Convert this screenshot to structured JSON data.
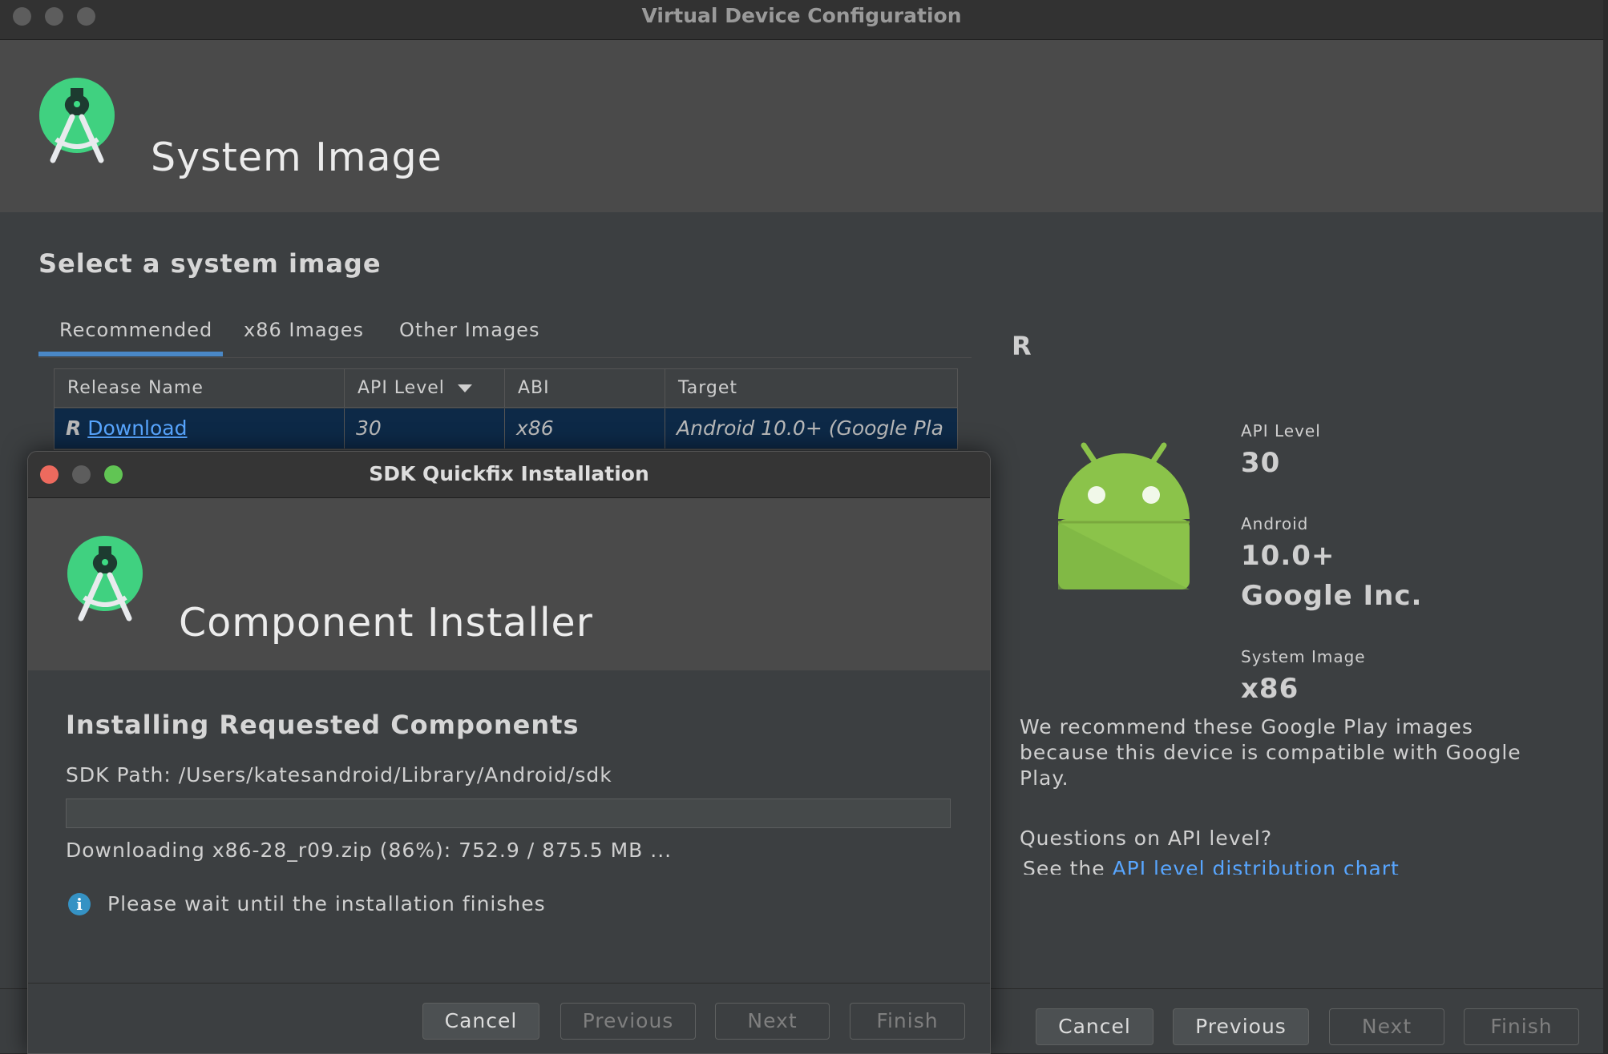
{
  "main_window": {
    "title": "Virtual Device Configuration",
    "header_title": "System Image",
    "section_heading": "Select a system image",
    "tabs": [
      {
        "label": "Recommended",
        "active": true
      },
      {
        "label": "x86 Images",
        "active": false
      },
      {
        "label": "Other Images",
        "active": false
      }
    ],
    "table": {
      "columns": [
        "Release Name",
        "API Level",
        "ABI",
        "Target"
      ],
      "rows": [
        {
          "release_prefix": "R",
          "release_link": "Download",
          "api_level": "30",
          "abi": "x86",
          "target": "Android 10.0+ (Google Pla"
        }
      ]
    },
    "details": {
      "release_letter": "R",
      "api_level_label": "API Level",
      "api_level_value": "30",
      "android_label": "Android",
      "android_version": "10.0+",
      "vendor": "Google Inc.",
      "system_image_label": "System Image",
      "system_image_value": "x86",
      "recommendation": "We recommend these Google Play images because this device is compatible with Google Play.",
      "questions": "Questions on API level?",
      "see_the": "See the",
      "api_link": "API level distribution chart"
    },
    "buttons": {
      "cancel": "Cancel",
      "previous": "Previous",
      "next": "Next",
      "finish": "Finish"
    }
  },
  "dialog": {
    "title": "SDK Quickfix Installation",
    "header_title": "Component Installer",
    "heading": "Installing Requested Components",
    "sdk_path": "SDK Path:  /Users/katesandroid/Library/Android/sdk",
    "download_status": "Downloading x86-28_r09.zip (86%): 752.9 / 875.5 MB ...",
    "progress_fraction": 0.86,
    "wait_message": "Please wait until the installation finishes",
    "buttons": {
      "cancel": "Cancel",
      "previous": "Previous",
      "next": "Next",
      "finish": "Finish"
    }
  },
  "colors": {
    "accent": "#4a88c7",
    "link": "#58a6ff",
    "traffic_close": "#ed6a5e",
    "traffic_minimize": "#5d5d5d",
    "traffic_zoom": "#61c554",
    "android_green": "#8bc34a"
  },
  "icons": [
    "android-studio-logo-icon",
    "android-robot-icon",
    "info-icon",
    "sort-descending-icon"
  ]
}
